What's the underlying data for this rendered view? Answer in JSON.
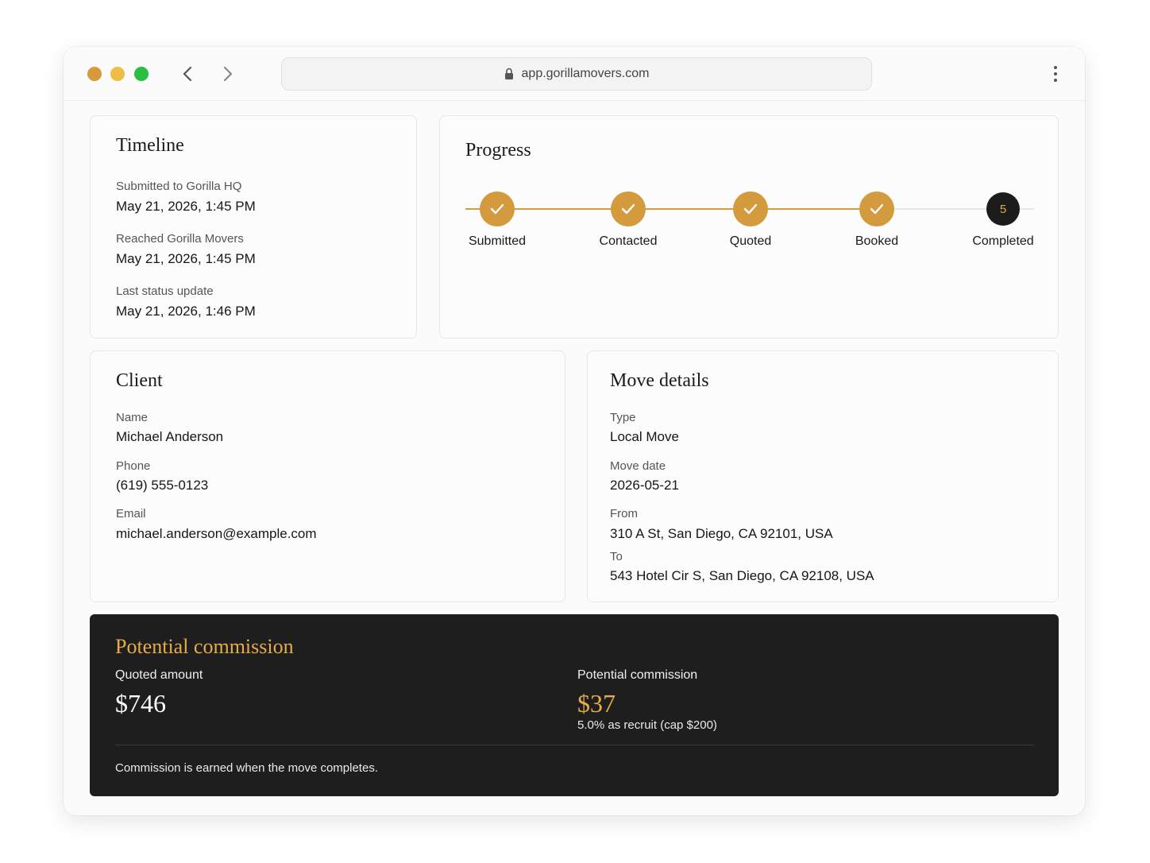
{
  "browser": {
    "url": "app.gorillamovers.com",
    "colors": {
      "close": "#d69a3a",
      "minimize": "#efbd46",
      "maximize": "#29c041"
    }
  },
  "timeline": {
    "title": "Timeline",
    "entries": [
      {
        "label": "Submitted to Gorilla HQ",
        "value": "May 21, 2026, 1:45 PM"
      },
      {
        "label": "Reached Gorilla Movers",
        "value": "May 21, 2026, 1:45 PM"
      },
      {
        "label": "Last status update",
        "value": "May 21, 2026, 1:46 PM"
      }
    ]
  },
  "progress": {
    "title": "Progress",
    "accent": "#d39a3e",
    "steps": [
      {
        "label": "Submitted",
        "status": "done"
      },
      {
        "label": "Contacted",
        "status": "done"
      },
      {
        "label": "Quoted",
        "status": "done"
      },
      {
        "label": "Booked",
        "status": "done"
      },
      {
        "label": "Completed",
        "status": "current",
        "number": "5"
      }
    ]
  },
  "client": {
    "title": "Client",
    "fields": [
      {
        "label": "Name",
        "value": "Michael Anderson"
      },
      {
        "label": "Phone",
        "value": "(619) 555-0123"
      },
      {
        "label": "Email",
        "value": "michael.anderson@example.com"
      }
    ]
  },
  "move": {
    "title": "Move details",
    "fields": [
      {
        "label": "Type",
        "value": "Local Move"
      },
      {
        "label": "Move date",
        "value": "2026-05-21"
      },
      {
        "label": "From",
        "value": "310 A St, San Diego, CA 92101, USA"
      },
      {
        "label": "To",
        "value": "543 Hotel Cir S, San Diego, CA 92108, USA"
      }
    ]
  },
  "commission": {
    "title": "Potential commission",
    "quoted_label": "Quoted amount",
    "quoted_value": "$746",
    "commission_label": "Potential commission",
    "commission_value": "$37",
    "commission_detail": "5.0% as recruit (cap $200)",
    "note": "Commission is earned when the move completes.",
    "accent": "#e6ac47",
    "background": "#1e1e1e"
  }
}
